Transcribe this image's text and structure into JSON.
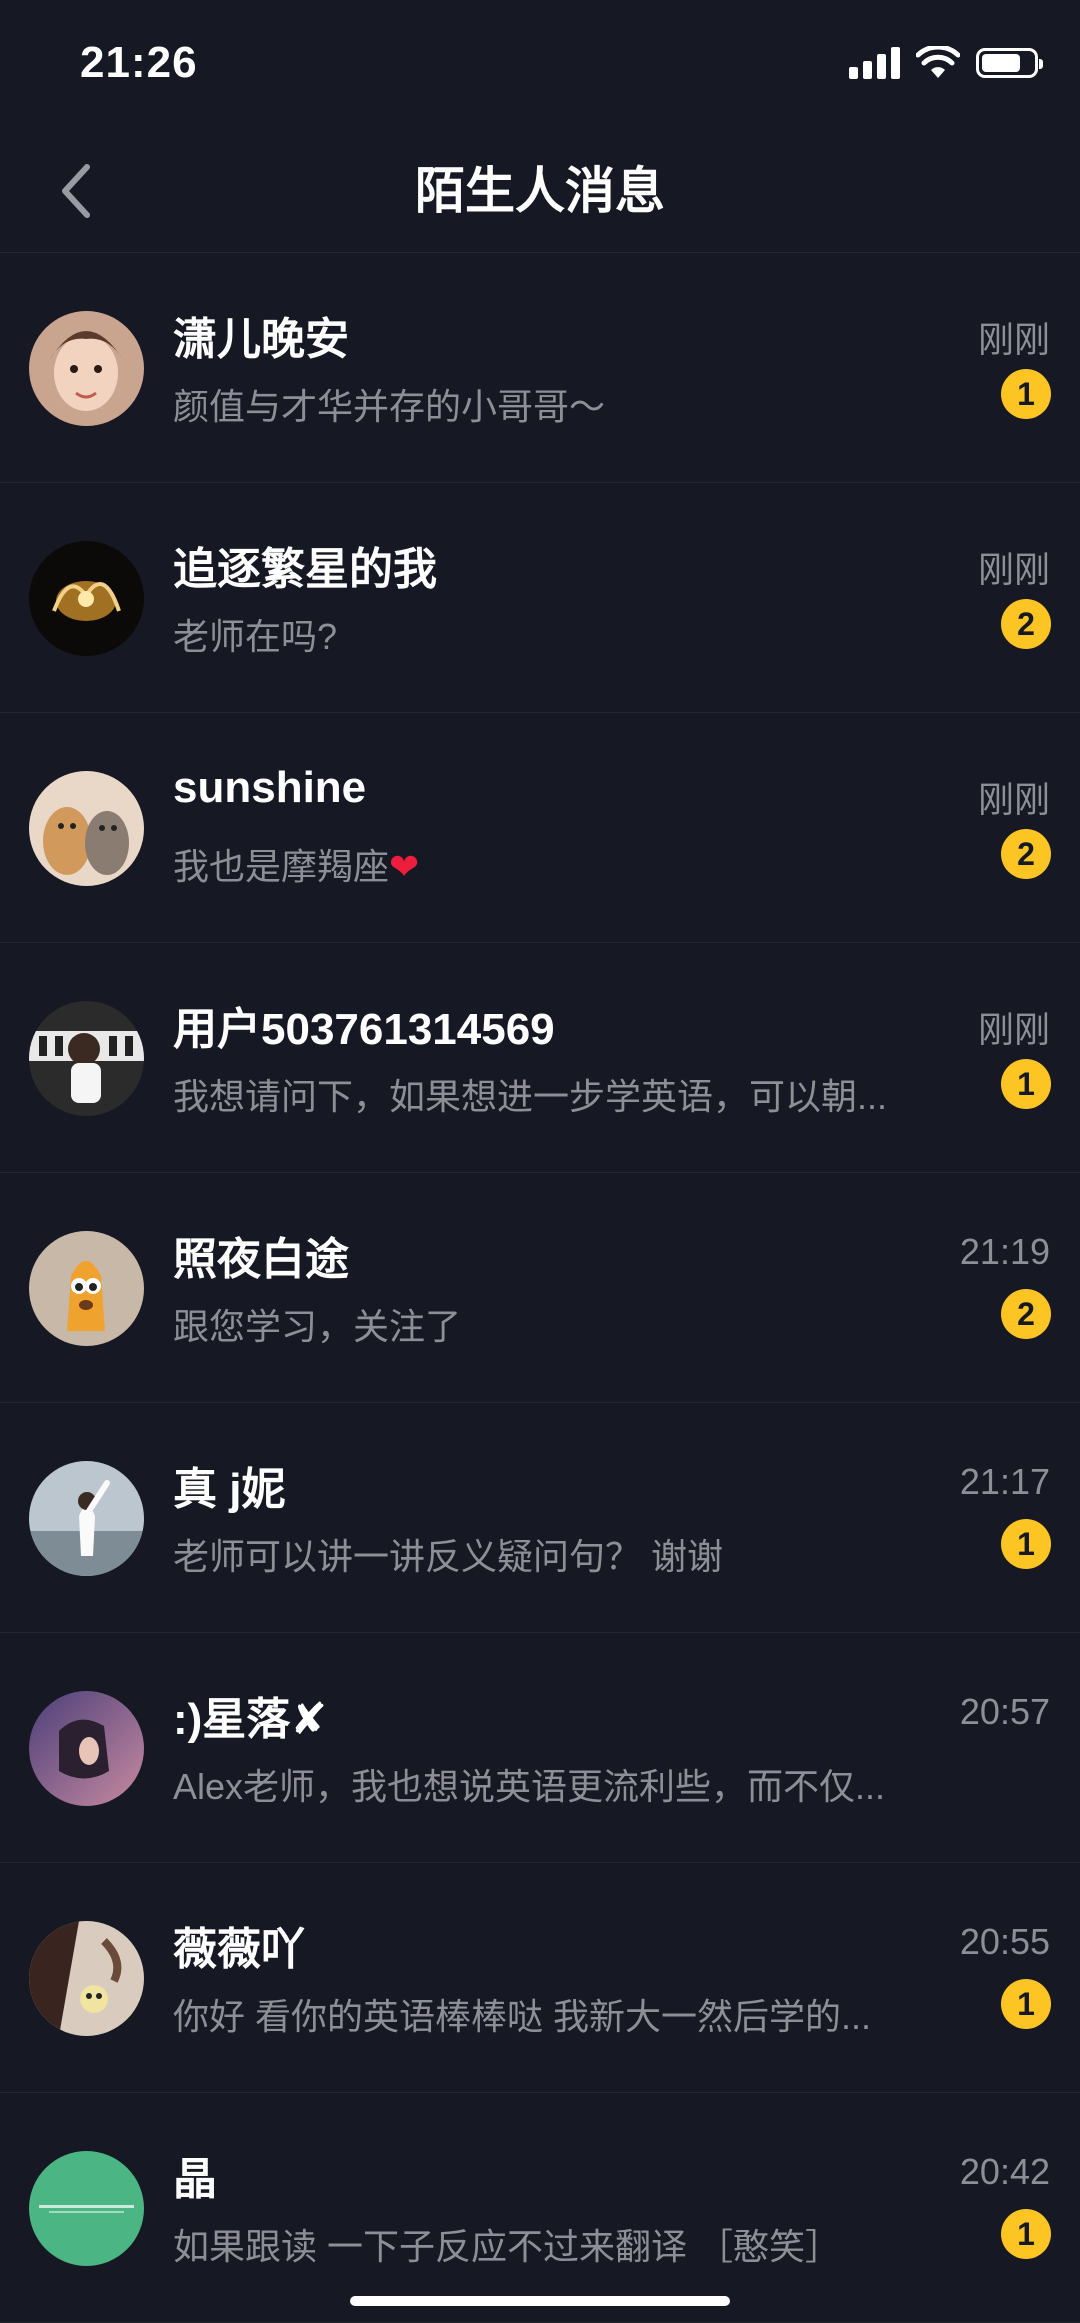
{
  "status_bar": {
    "time": "21:26"
  },
  "header": {
    "title": "陌生人消息"
  },
  "conversations": [
    {
      "name": "潇儿晚安",
      "preview": "颜值与才华并存的小哥哥～",
      "time": "刚刚",
      "unread": "1"
    },
    {
      "name": "追逐繁星的我",
      "preview": "老师在吗?",
      "time": "刚刚",
      "unread": "2"
    },
    {
      "name": "sunshine",
      "preview": " 我也是摩羯座",
      "time": "刚刚",
      "unread": "2"
    },
    {
      "name": "用户503761314569",
      "preview": "我想请问下，如果想进一步学英语，可以朝...",
      "time": "刚刚",
      "unread": "1"
    },
    {
      "name": "照夜白途",
      "preview": "跟您学习，关注了",
      "time": "21:19",
      "unread": "2"
    },
    {
      "name": "真 j妮",
      "preview": "老师可以讲一讲反义疑问句？ 谢谢",
      "time": "21:17",
      "unread": "1"
    },
    {
      "name": ":)星落✘",
      "preview": "Alex老师，我也想说英语更流利些，而不仅...",
      "time": "20:57",
      "unread": ""
    },
    {
      "name": "薇薇吖",
      "preview": "你好 看你的英语棒棒哒 我新大一然后学的...",
      "time": "20:55",
      "unread": "1"
    },
    {
      "name": "晶",
      "preview": "如果跟读  一下子反应不过来翻译 ［憨笑］",
      "time": "20:42",
      "unread": "1"
    }
  ],
  "colors": {
    "background": "#161823",
    "badge": "#fdc524",
    "secondary_text": "#8e8f96"
  },
  "icons": [
    "back-chevron-icon",
    "signal-icon",
    "wifi-icon",
    "battery-icon",
    "heart-icon"
  ]
}
